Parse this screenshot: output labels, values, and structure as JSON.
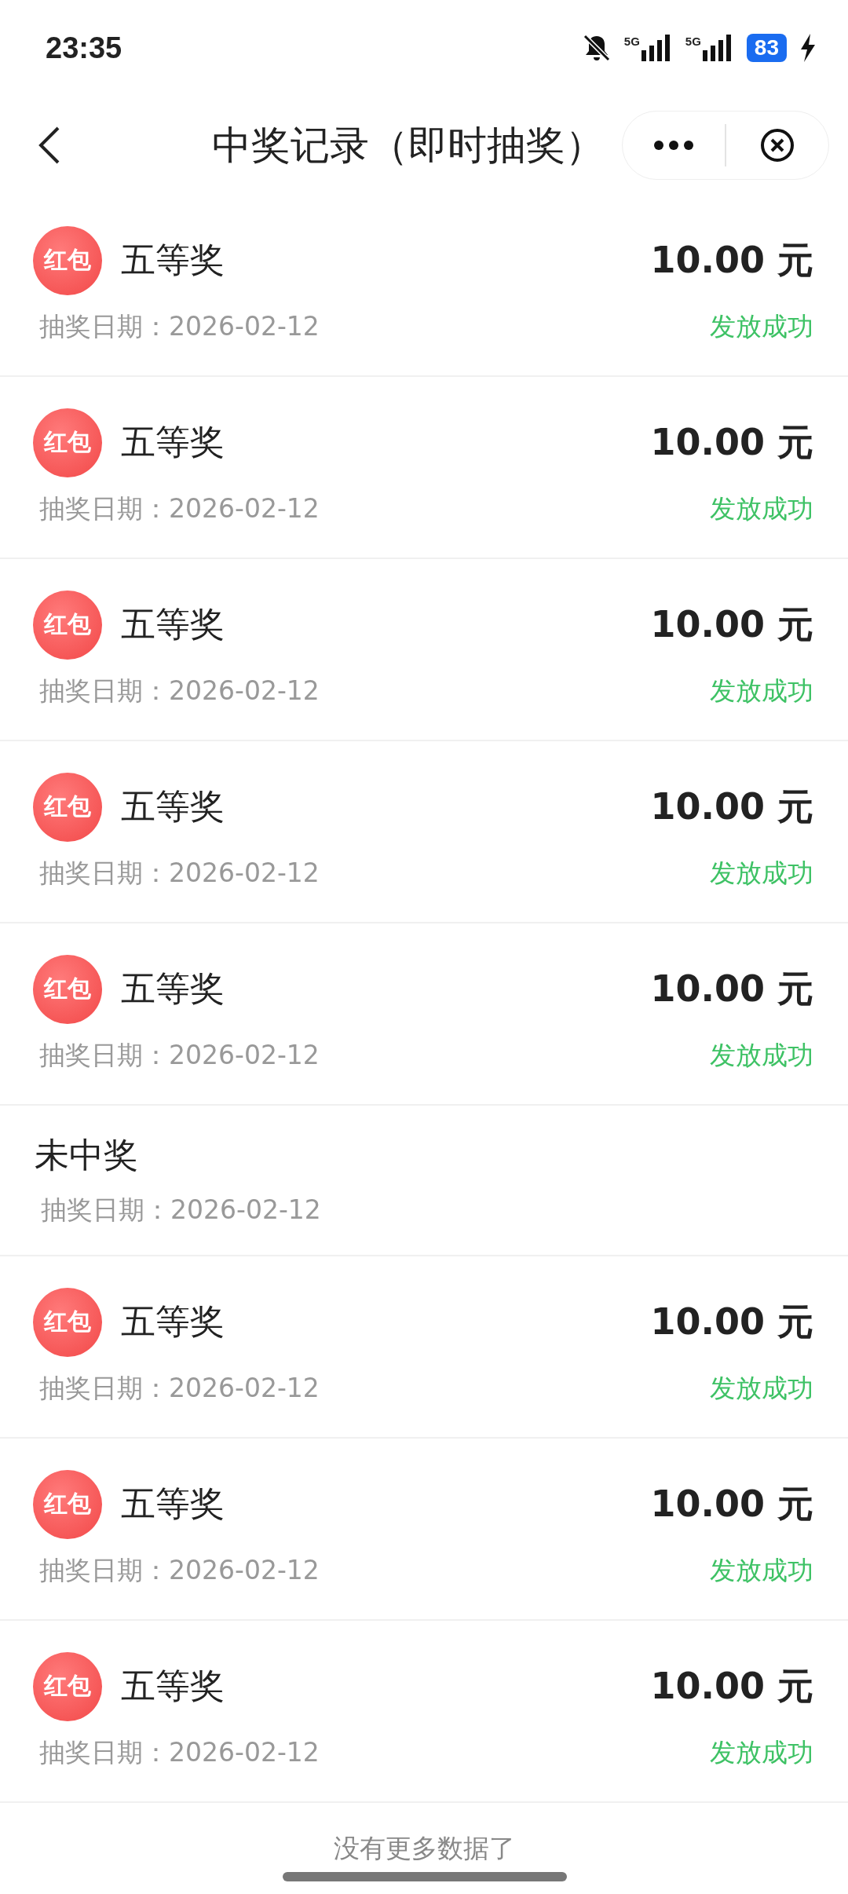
{
  "status_bar": {
    "time": "23:35",
    "networks": [
      "5G",
      "5G"
    ],
    "battery": "83",
    "charging": true,
    "muted": true
  },
  "header": {
    "title": "中奖记录（即时抽奖）"
  },
  "records": [
    {
      "kind": "prize",
      "badge": "红包",
      "name": "五等奖",
      "amount": "10.00 元",
      "date": "抽奖日期：2026-02-12",
      "status": "发放成功"
    },
    {
      "kind": "prize",
      "badge": "红包",
      "name": "五等奖",
      "amount": "10.00 元",
      "date": "抽奖日期：2026-02-12",
      "status": "发放成功"
    },
    {
      "kind": "prize",
      "badge": "红包",
      "name": "五等奖",
      "amount": "10.00 元",
      "date": "抽奖日期：2026-02-12",
      "status": "发放成功"
    },
    {
      "kind": "prize",
      "badge": "红包",
      "name": "五等奖",
      "amount": "10.00 元",
      "date": "抽奖日期：2026-02-12",
      "status": "发放成功"
    },
    {
      "kind": "prize",
      "badge": "红包",
      "name": "五等奖",
      "amount": "10.00 元",
      "date": "抽奖日期：2026-02-12",
      "status": "发放成功"
    },
    {
      "kind": "none",
      "name": "未中奖",
      "date": "抽奖日期：2026-02-12"
    },
    {
      "kind": "prize",
      "badge": "红包",
      "name": "五等奖",
      "amount": "10.00 元",
      "date": "抽奖日期：2026-02-12",
      "status": "发放成功"
    },
    {
      "kind": "prize",
      "badge": "红包",
      "name": "五等奖",
      "amount": "10.00 元",
      "date": "抽奖日期：2026-02-12",
      "status": "发放成功"
    },
    {
      "kind": "prize",
      "badge": "红包",
      "name": "五等奖",
      "amount": "10.00 元",
      "date": "抽奖日期：2026-02-12",
      "status": "发放成功"
    }
  ],
  "footer": "没有更多数据了"
}
